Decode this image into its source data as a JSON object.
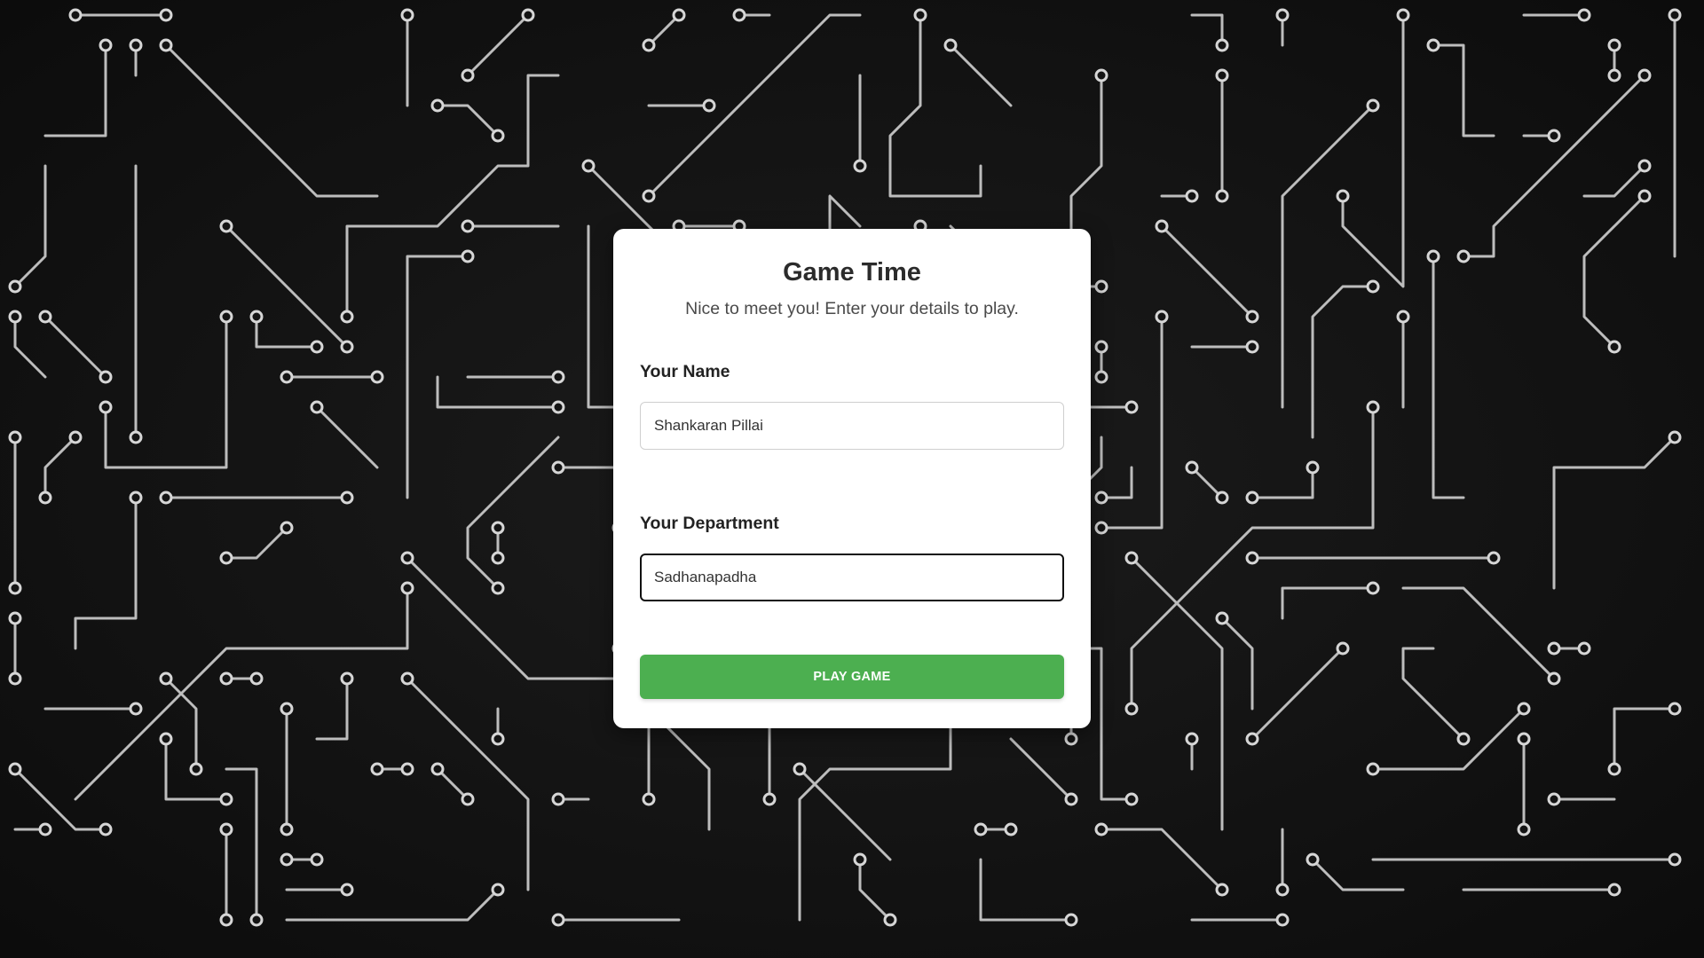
{
  "card": {
    "title": "Game Time",
    "subtitle": "Nice to meet you! Enter your details to play."
  },
  "form": {
    "name_label": "Your Name",
    "name_value": "Shankaran Pillai",
    "department_label": "Your Department",
    "department_value": "Sadhanapadha",
    "submit_label": "PLAY GAME"
  },
  "colors": {
    "background": "#141414",
    "circuit_trace": "#bdbdbd",
    "button": "#4caf50",
    "card": "#ffffff"
  }
}
